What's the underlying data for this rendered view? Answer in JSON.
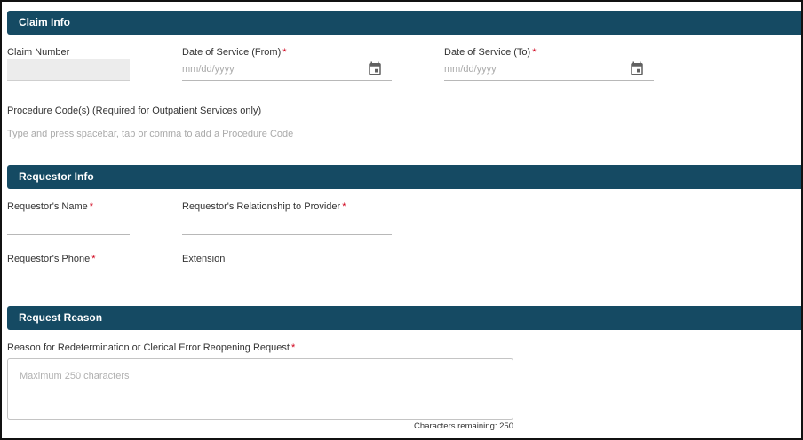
{
  "sections": {
    "claim_info": "Claim Info",
    "requestor_info": "Requestor Info",
    "request_reason": "Request Reason"
  },
  "claim": {
    "claim_number_label": "Claim Number",
    "dos_from_label": "Date of Service (From)",
    "dos_from_placeholder": "mm/dd/yyyy",
    "dos_to_label": "Date of Service (To)",
    "dos_to_placeholder": "mm/dd/yyyy",
    "procedure_label": "Procedure Code(s) (Required for Outpatient Services only)",
    "procedure_placeholder": "Type and press spacebar, tab or comma to add a Procedure Code",
    "calendar_icon": "calendar-icon"
  },
  "requestor": {
    "name_label": "Requestor's Name",
    "relationship_label": "Requestor's Relationship to Provider",
    "phone_label": "Requestor's Phone",
    "extension_label": "Extension"
  },
  "reason": {
    "reason_label": "Reason for Redetermination or Clerical Error Reopening Request",
    "reason_placeholder": "Maximum 250 characters",
    "counter_text": "Characters remaining: 250"
  },
  "required_marker": "*",
  "colors": {
    "section_bar": "#154a63",
    "required": "#d0021b",
    "placeholder": "#aaaaaa"
  }
}
